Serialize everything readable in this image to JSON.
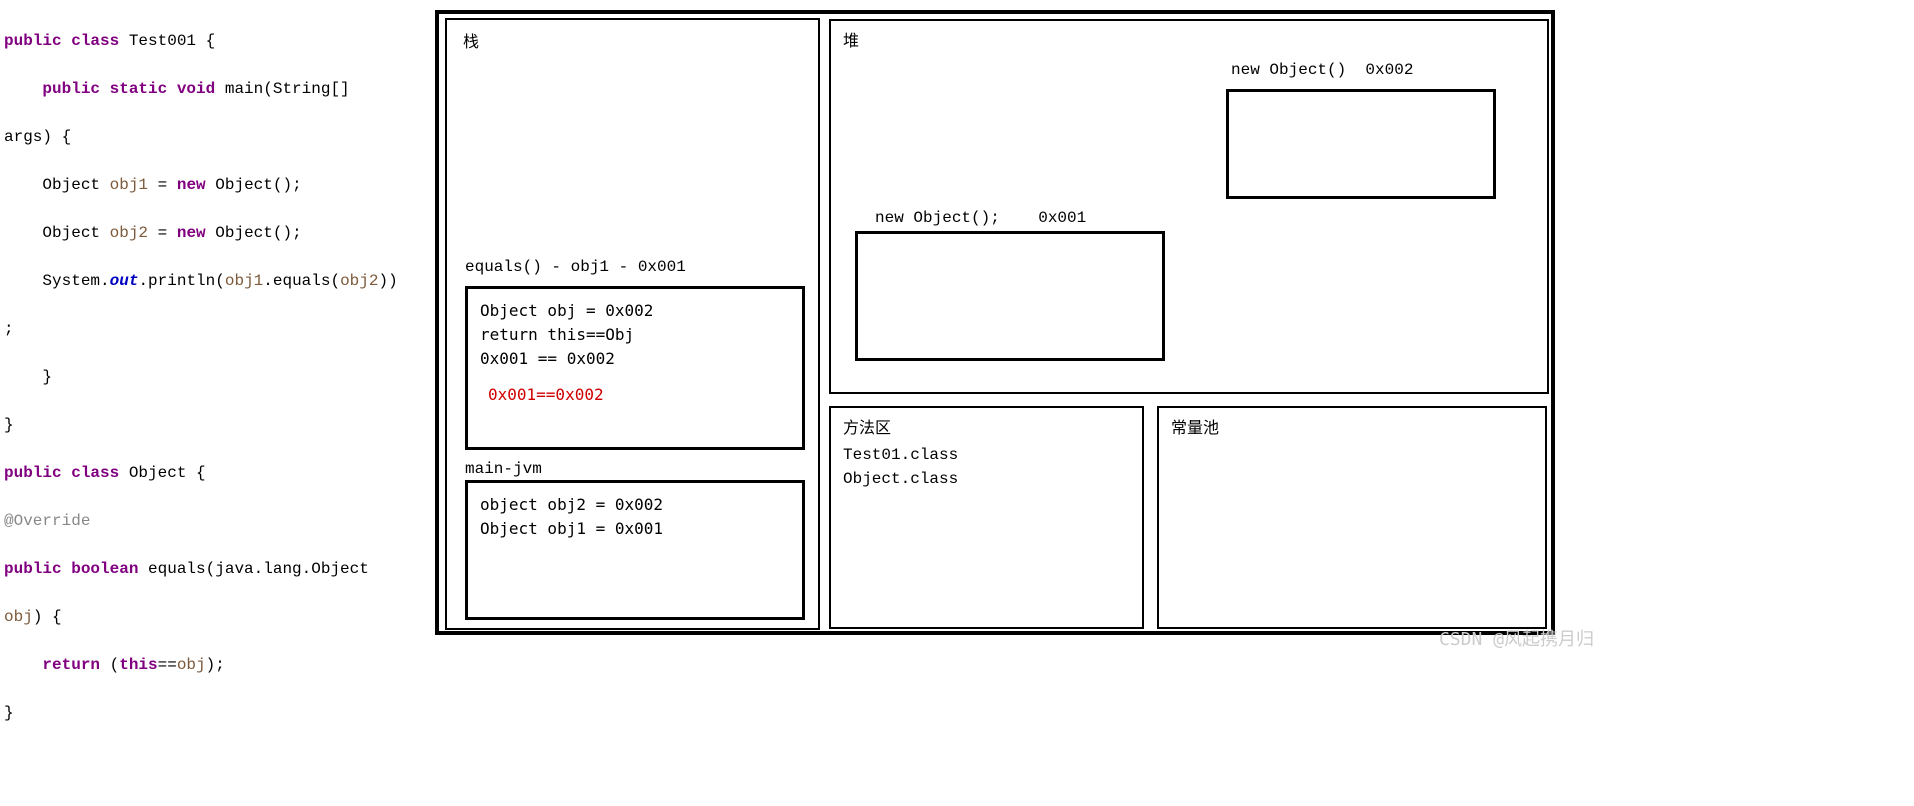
{
  "code": {
    "line1_kw": "public class",
    "line1_cls": " Test001 {",
    "line2_kw": "    public static void",
    "line2_tail": " main(String[]",
    "line3": "args) {",
    "line4a": "    Object ",
    "line4var1": "obj1",
    "line4b": " = ",
    "line4kw": "new",
    "line4c": " Object();",
    "line5a": "    Object ",
    "line5var1": "obj2",
    "line5b": " = ",
    "line5kw": "new",
    "line5c": " Object();",
    "line6a": "    System.",
    "line6out": "out",
    "line6b": ".println(",
    "line6_obj1": "obj1",
    "line6c": ".equals(",
    "line6_obj2": "obj2",
    "line6d": "))",
    "line7": ";",
    "line8": "    }",
    "line9": "}",
    "line10_kw": "public class",
    "line10_cls": " Object {",
    "line11_ann": "@Override",
    "line12_kw": "public boolean",
    "line12_tail": " equals(java.lang.Object",
    "line13a": "obj",
    "line13_tail": ") {",
    "line14a": "    ",
    "line14_kw": "return",
    "line14b": " (",
    "line14_this": "this",
    "line14c": "==",
    "line14_obj": "obj",
    "line14d": ");",
    "line15": "}"
  },
  "stack": {
    "title": "栈",
    "equals_label": "equals() - obj1 - 0x001",
    "equals_frame_line1": "Object obj = 0x002",
    "equals_frame_line2": "return this==Obj",
    "equals_frame_line3": "0x001 == 0x002",
    "equals_frame_red": "0x001==0x002",
    "main_label": "main-jvm",
    "main_line1": "object obj2 = 0x002",
    "main_line2": "Object obj1 = 0x001"
  },
  "heap": {
    "title": "堆",
    "obj001_label": "new Object();    0x001",
    "obj002_label": "new Object()  0x002"
  },
  "method_area": {
    "title": "方法区",
    "item1": "Test01.class",
    "item2": "Object.class"
  },
  "const_pool": {
    "title": "常量池"
  },
  "watermark": "CSDN @风起携月归"
}
